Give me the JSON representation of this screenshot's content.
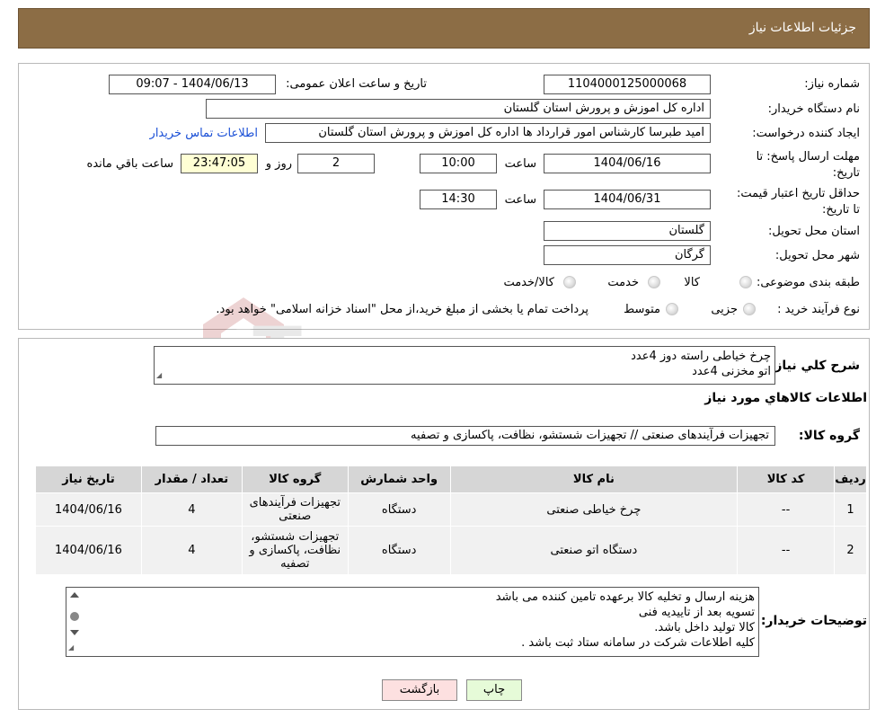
{
  "header": {
    "title": "جزئیات اطلاعات نیاز"
  },
  "form": {
    "need_number_label": "شماره نیاز:",
    "need_number": "1104000125000068",
    "announce_label": "تاریخ و ساعت اعلان عمومی:",
    "announce_value": "1404/06/13 - 09:07",
    "buyer_org_label": "نام دستگاه خریدار:",
    "buyer_org": "اداره کل اموزش و پرورش استان گلستان",
    "requester_label": "ایجاد کننده درخواست:",
    "requester": "امید طبرسا کارشناس امور قرارداد ها اداره کل اموزش و پرورش استان گلستان",
    "contact_link": "اطلاعات تماس خریدار",
    "deadline_label": "مهلت ارسال پاسخ: تا تاریخ:",
    "deadline_date": "1404/06/16",
    "time_label": "ساعت",
    "deadline_time": "10:00",
    "days_value": "2",
    "days_label": "روز و",
    "remaining_time": "23:47:05",
    "remaining_label": "ساعت باقي مانده",
    "validity_label": "حداقل تاریخ اعتبار قیمت: تا تاریخ:",
    "validity_date": "1404/06/31",
    "validity_time": "14:30",
    "province_label": "استان محل تحویل:",
    "province": "گلستان",
    "city_label": "شهر محل تحویل:",
    "city": "گرگان",
    "category_label": "طبقه بندی موضوعی:",
    "category_options": [
      "کالا",
      "خدمت",
      "کالا/خدمت"
    ],
    "process_label": "نوع فرآیند خرید :",
    "process_options": [
      "جزیی",
      "متوسط"
    ],
    "process_note": "پرداخت تمام یا بخشی از مبلغ خرید،از محل \"اسناد خزانه اسلامی\" خواهد بود."
  },
  "general": {
    "label": "شرح کلي نیاز:",
    "lines": [
      "چرخ خیاطی  راسته دوز 4عدد",
      "اتو مخزنی 4عدد"
    ]
  },
  "goods_section_title": "اطلاعات کالاهاي مورد نیاز",
  "goods_group_label": "گروه کالا:",
  "goods_group": "تجهیزات فرآیندهای صنعتی // تجهیزات شستشو، نظافت، پاکسازی و تصفیه",
  "table": {
    "headers": [
      "ردیف",
      "کد کالا",
      "نام کالا",
      "واحد شمارش",
      "گروه کالا",
      "تعداد / مقدار",
      "تاریخ نیاز"
    ],
    "rows": [
      [
        "1",
        "--",
        "چرخ خیاطی صنعتی",
        "دستگاه",
        "تجهیزات فرآیندهای صنعتی",
        "4",
        "1404/06/16"
      ],
      [
        "2",
        "--",
        "دستگاه اتو صنعتی",
        "دستگاه",
        "تجهیزات شستشو، نظافت، پاکسازی و تصفیه",
        "4",
        "1404/06/16"
      ]
    ]
  },
  "notes": {
    "label": "توضیحات خریدار:",
    "lines": [
      "هزینه ارسال و تخلیه کالا برعهده تامین کننده می باشد",
      "تسویه بعد از تاییدیه فنی",
      "کالا تولید داخل باشد.",
      "کلیه اطلاعات شرکت در سامانه ستاد ثبت باشد ."
    ]
  },
  "buttons": {
    "print": "چاپ",
    "back": "بازگشت"
  },
  "watermark": {
    "text": "AriaTender.neT"
  }
}
